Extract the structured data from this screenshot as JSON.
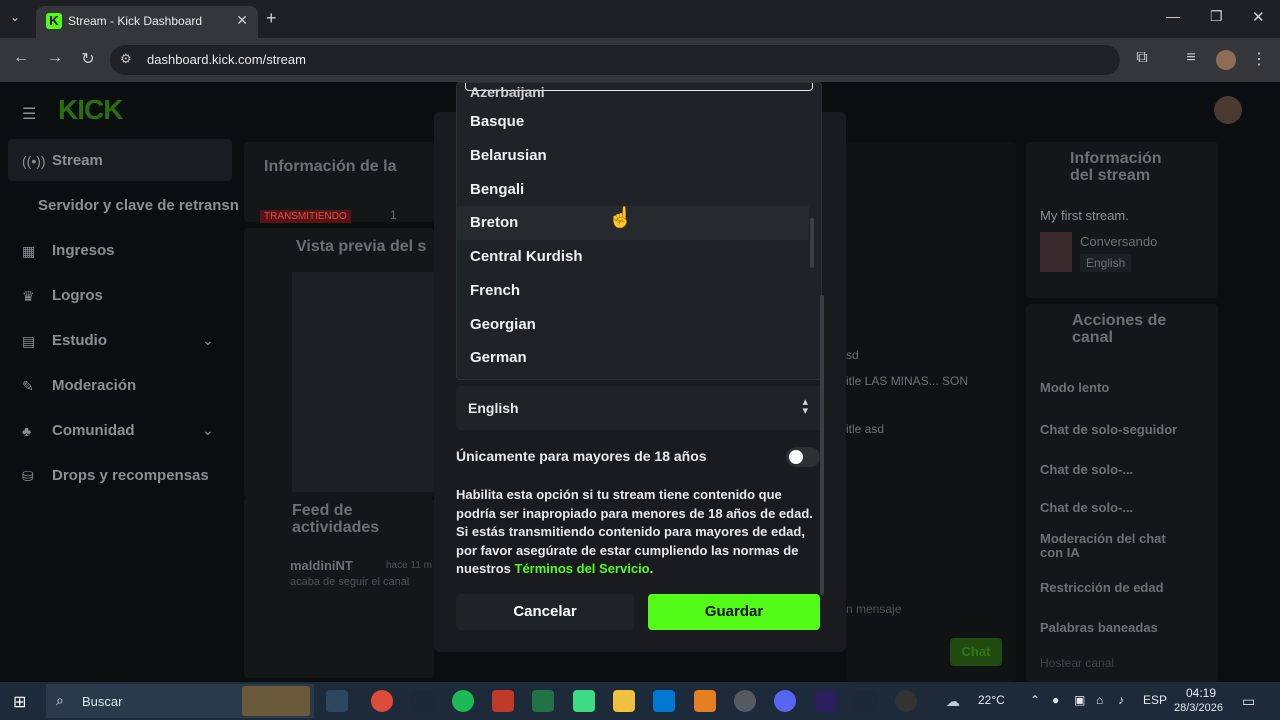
{
  "browser": {
    "tab_title": "Stream - Kick Dashboard",
    "url": "dashboard.kick.com/stream"
  },
  "sidebar": {
    "items": [
      {
        "label": "Stream"
      },
      {
        "label": "Servidor y clave de retransn"
      },
      {
        "label": "Ingresos"
      },
      {
        "label": "Logros"
      },
      {
        "label": "Estudio"
      },
      {
        "label": "Moderación"
      },
      {
        "label": "Comunidad"
      },
      {
        "label": "Drops y recompensas"
      }
    ]
  },
  "background": {
    "info_title": "Información de la",
    "live_badge": "TRANSMITIENDO",
    "live_count": "1",
    "preview_title": "Vista previa del s",
    "feed_title": "Feed de actividades",
    "feed_user": "maldiniNT",
    "feed_time": "hace 11 m",
    "feed_action": "acaba de seguir el canal",
    "stream_info_title": "Información del stream",
    "stream_title": "My first stream.",
    "category": "Conversando",
    "language_tag": "English",
    "actions_title": "Acciones de canal",
    "actions": [
      "Modo lento",
      "Chat de solo-seguidor",
      "Chat de solo-...",
      "Chat de solo-...",
      "Moderación del chat con IA",
      "Restricción de edad",
      "Palabras baneadas",
      "Hostear canal"
    ],
    "chat_snippets": [
      "sd",
      "itle LAS MINAS... SON",
      "itle asd"
    ],
    "chat_placeholder": "n mensaje",
    "chat_button": "Chat"
  },
  "modal": {
    "dropdown_partial": "Azerbaijani",
    "language_options": [
      "Basque",
      "Belarusian",
      "Bengali",
      "Breton",
      "Central Kurdish",
      "French",
      "Georgian",
      "German"
    ],
    "hovered_option": "Breton",
    "selected_language": "English",
    "mature_label": "Únicamente para mayores de 18 años",
    "mature_enabled": false,
    "mature_desc": "Habilita esta opción si tu stream tiene contenido que podría ser inapropiado para menores de 18 años de edad. Si estás transmitiendo contenido para mayores de edad, por favor asegúrate de estar cumpliendo las normas de nuestros ",
    "terms_link": "Términos del Servicio",
    "desc_end": ".",
    "cancel_label": "Cancelar",
    "save_label": "Guardar"
  },
  "taskbar": {
    "search_placeholder": "Buscar",
    "weather": "22°C",
    "language": "ESP",
    "time": "04:19",
    "date": "28/3/2026"
  },
  "colors": {
    "accent": "#53fc18",
    "modal_bg": "#191b1f",
    "page_bg": "#0b0e0f"
  }
}
